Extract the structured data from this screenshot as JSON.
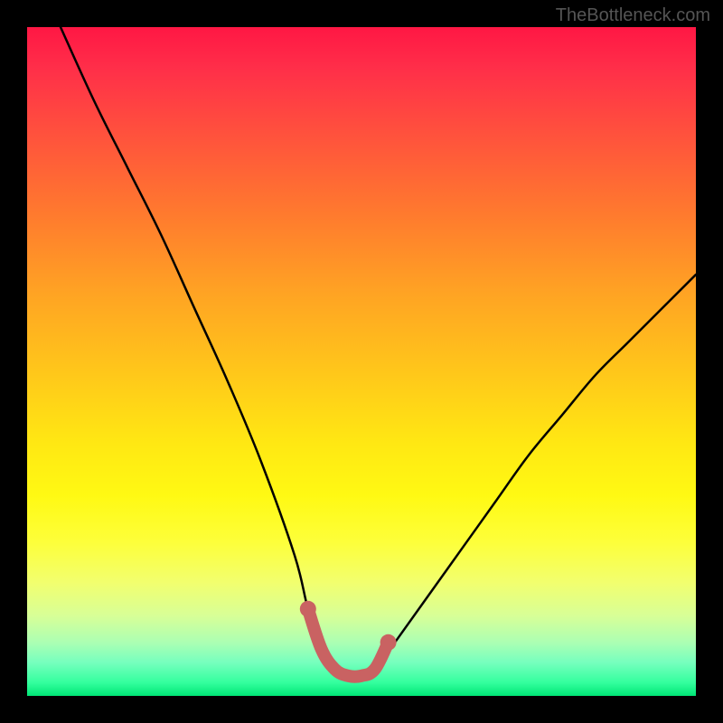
{
  "watermark": "TheBottleneck.com",
  "chart_data": {
    "type": "line",
    "title": "",
    "xlabel": "",
    "ylabel": "",
    "xlim": [
      0,
      100
    ],
    "ylim": [
      0,
      100
    ],
    "series": [
      {
        "name": "bottleneck-curve",
        "x": [
          5,
          10,
          15,
          20,
          25,
          30,
          35,
          40,
          42,
          44,
          46,
          48,
          50,
          52,
          55,
          60,
          65,
          70,
          75,
          80,
          85,
          90,
          95,
          100
        ],
        "y": [
          100,
          89,
          79,
          69,
          58,
          47,
          35,
          21,
          13,
          7,
          4,
          3,
          3,
          4,
          8,
          15,
          22,
          29,
          36,
          42,
          48,
          53,
          58,
          63
        ]
      },
      {
        "name": "highlight-segment",
        "x": [
          42,
          44,
          46,
          48,
          50,
          52,
          54
        ],
        "y": [
          13,
          7,
          4,
          3,
          3,
          4,
          8
        ]
      }
    ],
    "gradient_scale": {
      "top_color": "#ff1744",
      "bottom_color": "#00e676",
      "meaning": "top=high bottleneck, bottom=low bottleneck"
    }
  }
}
